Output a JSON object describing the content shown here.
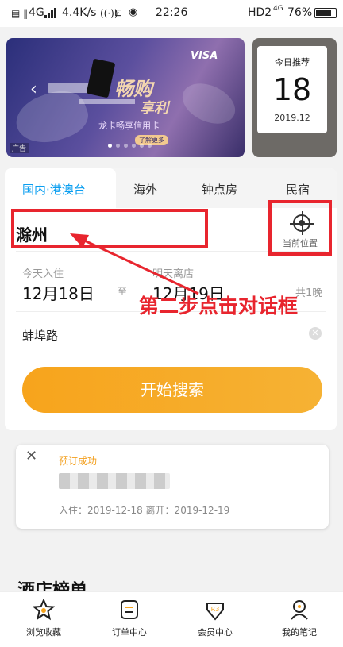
{
  "status_bar": {
    "network": "4G",
    "speed": "4.4K/s",
    "time": "22:26",
    "hd": "HD2",
    "network2": "4G",
    "battery": "76%"
  },
  "banner": {
    "visa": "VISA",
    "headline1": "畅购",
    "headline2": "享利",
    "subtitle": "龙卡畅享信用卡",
    "cta": "了解更多",
    "ad_tag": "广告"
  },
  "recommend": {
    "label": "今日推荐",
    "day": "18",
    "month": "2019.12"
  },
  "tabs": [
    {
      "label": "国内·港澳台",
      "active": true
    },
    {
      "label": "海外",
      "active": false
    },
    {
      "label": "钟点房",
      "active": false
    },
    {
      "label": "民宿",
      "active": false
    }
  ],
  "search": {
    "destination": "滁州",
    "location_label": "当前位置",
    "checkin_label": "今天入住",
    "checkin_date": "12月18日",
    "to_label": "至",
    "checkout_label": "明天离店",
    "checkout_date": "12月19日",
    "nights": "共1晚",
    "keyword": "蚌埠路",
    "search_button": "开始搜索"
  },
  "annotation": "第二步点击对话框",
  "booking": {
    "status": "预订成功",
    "info": "入住：2019-12-18 离开：2019-12-19"
  },
  "section_title": "酒店榜单",
  "bottom_nav": [
    {
      "label": "浏览收藏",
      "icon": "star-icon"
    },
    {
      "label": "订单中心",
      "icon": "order-icon"
    },
    {
      "label": "会员中心",
      "icon": "member-icon"
    },
    {
      "label": "我的笔记",
      "icon": "notes-icon"
    }
  ],
  "colors": {
    "accent": "#0a9ef0",
    "search_button": "#f7a41c",
    "annotation_red": "#e8252e"
  }
}
